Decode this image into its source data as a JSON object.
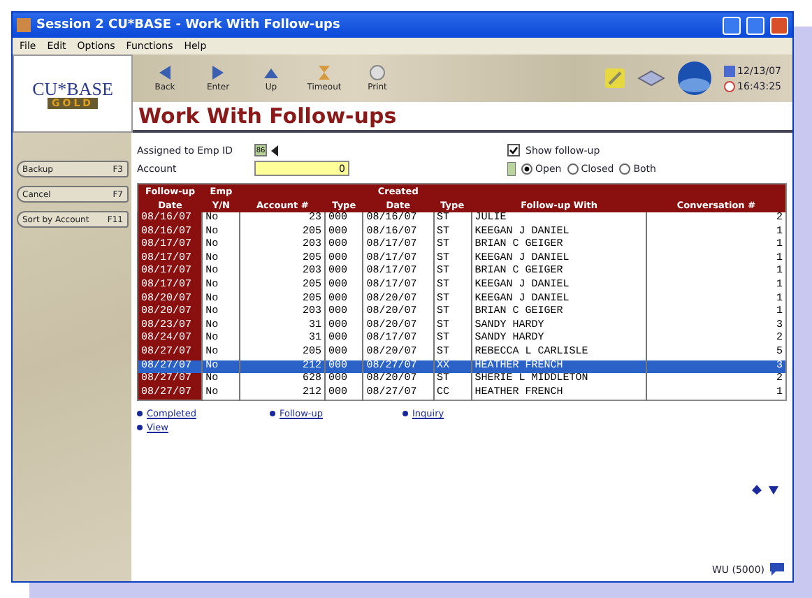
{
  "window": {
    "title": "Session 2 CU*BASE - Work With Follow-ups"
  },
  "menu": [
    "File",
    "Edit",
    "Options",
    "Functions",
    "Help"
  ],
  "logo": {
    "name": "CU*BASE",
    "edition": "GOLD"
  },
  "toolbar": [
    {
      "label": "Back",
      "kind": "back"
    },
    {
      "label": "Enter",
      "kind": "enter"
    },
    {
      "label": "Up",
      "kind": "up"
    },
    {
      "label": "Timeout",
      "kind": "timeout"
    },
    {
      "label": "Print",
      "kind": "print"
    }
  ],
  "clock": {
    "date": "12/13/07",
    "time": "16:43:25"
  },
  "page_title": "Work With Follow-ups",
  "sidebar": [
    {
      "label": "Backup",
      "key": "F3"
    },
    {
      "label": "Cancel",
      "key": "F7"
    },
    {
      "label": "Sort by Account",
      "key": "F11"
    }
  ],
  "form": {
    "emp_label": "Assigned to Emp ID",
    "emp_value": "86",
    "account_label": "Account",
    "account_value": "0",
    "show_label": "Show follow-up",
    "show_checked": true,
    "status_options": [
      {
        "label": "Open",
        "selected": true
      },
      {
        "label": "Closed",
        "selected": false
      },
      {
        "label": "Both",
        "selected": false
      }
    ]
  },
  "table": {
    "columns": [
      {
        "top": "Follow-up",
        "label": "Date"
      },
      {
        "top": "Emp",
        "label": "Y/N"
      },
      {
        "label": "Account #"
      },
      {
        "label": "Type"
      },
      {
        "top": "Created",
        "label": "Date"
      },
      {
        "label": "Type"
      },
      {
        "label": "Follow-up With"
      },
      {
        "label": "Conversation #"
      }
    ],
    "rows": [
      {
        "cells": [
          "08/16/07",
          "No",
          "23",
          "000",
          "08/16/07",
          "ST",
          "JULIE",
          "2"
        ],
        "selected": false
      },
      {
        "cells": [
          "08/16/07",
          "No",
          "205",
          "000",
          "08/16/07",
          "ST",
          "KEEGAN J DANIEL",
          "1"
        ],
        "selected": false
      },
      {
        "cells": [
          "08/17/07",
          "No",
          "203",
          "000",
          "08/17/07",
          "ST",
          "BRIAN C GEIGER",
          "1"
        ],
        "selected": false
      },
      {
        "cells": [
          "08/17/07",
          "No",
          "205",
          "000",
          "08/17/07",
          "ST",
          "KEEGAN J DANIEL",
          "1"
        ],
        "selected": false
      },
      {
        "cells": [
          "08/17/07",
          "No",
          "203",
          "000",
          "08/17/07",
          "ST",
          "BRIAN C GEIGER",
          "1"
        ],
        "selected": false
      },
      {
        "cells": [
          "08/17/07",
          "No",
          "205",
          "000",
          "08/17/07",
          "ST",
          "KEEGAN J DANIEL",
          "1"
        ],
        "selected": false
      },
      {
        "cells": [
          "08/20/07",
          "No",
          "205",
          "000",
          "08/20/07",
          "ST",
          "KEEGAN J DANIEL",
          "1"
        ],
        "selected": false
      },
      {
        "cells": [
          "08/20/07",
          "No",
          "203",
          "000",
          "08/20/07",
          "ST",
          "BRIAN C GEIGER",
          "1"
        ],
        "selected": false
      },
      {
        "cells": [
          "08/23/07",
          "No",
          "31",
          "000",
          "08/20/07",
          "ST",
          "SANDY HARDY",
          "3"
        ],
        "selected": false
      },
      {
        "cells": [
          "08/24/07",
          "No",
          "31",
          "000",
          "08/17/07",
          "ST",
          "SANDY HARDY",
          "2"
        ],
        "selected": false
      },
      {
        "cells": [
          "08/27/07",
          "No",
          "205",
          "000",
          "08/20/07",
          "ST",
          "REBECCA L CARLISLE",
          "5"
        ],
        "selected": false
      },
      {
        "cells": [
          "08/27/07",
          "No",
          "212",
          "000",
          "08/27/07",
          "XX",
          "HEATHER FRENCH",
          "3"
        ],
        "selected": true
      },
      {
        "cells": [
          "08/27/07",
          "No",
          "628",
          "000",
          "08/20/07",
          "ST",
          "SHERIE L MIDDLETON",
          "2"
        ],
        "selected": false
      },
      {
        "cells": [
          "08/27/07",
          "No",
          "212",
          "000",
          "08/27/07",
          "CC",
          "HEATHER FRENCH",
          "1"
        ],
        "selected": false
      }
    ]
  },
  "legend": [
    "Completed",
    "Follow-up",
    "Inquiry",
    "View"
  ],
  "status_bar": {
    "code": "WU (5000)"
  }
}
